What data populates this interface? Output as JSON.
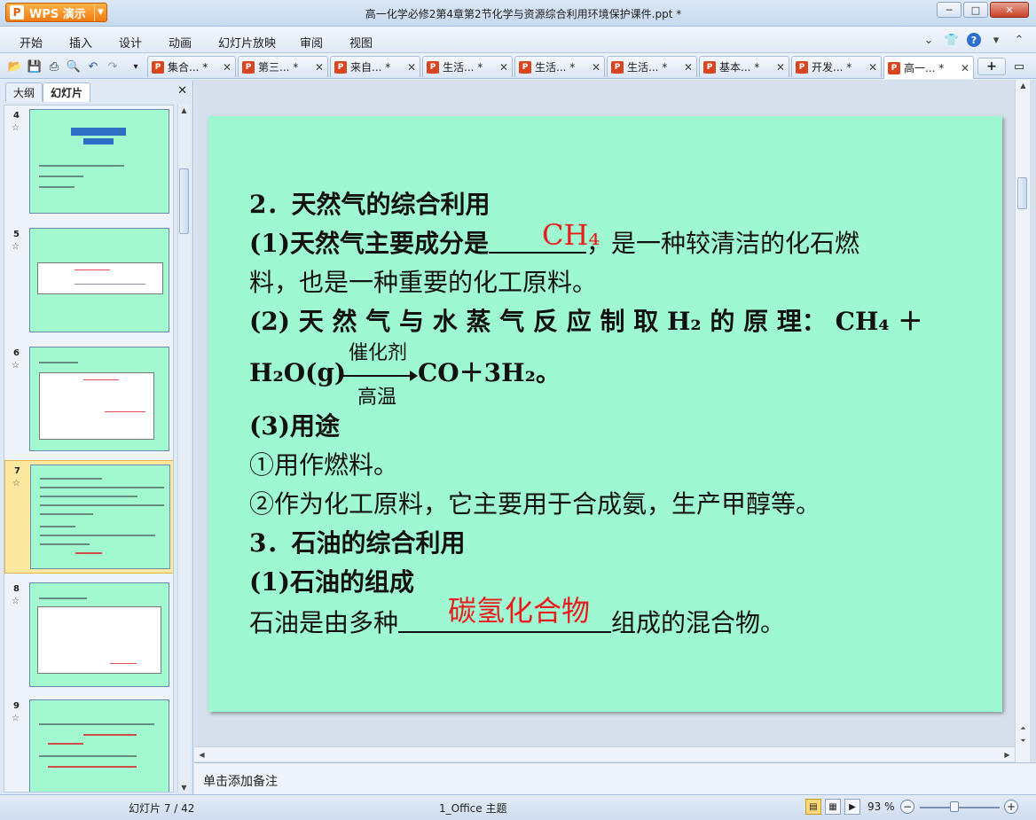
{
  "app": {
    "name": "WPS 演示",
    "logo_letter": "P"
  },
  "window": {
    "title": "高一化学必修2第4章第2节化学与资源综合利用环境保护课件.ppt *"
  },
  "menu": [
    "开始",
    "插入",
    "设计",
    "动画",
    "幻灯片放映",
    "审阅",
    "视图"
  ],
  "tabs": [
    {
      "label": "集合... *"
    },
    {
      "label": "第三... *"
    },
    {
      "label": "来自... *"
    },
    {
      "label": "生活... *"
    },
    {
      "label": "生活... *"
    },
    {
      "label": "生活... *"
    },
    {
      "label": "基本... *"
    },
    {
      "label": "开发... *"
    },
    {
      "label": "高一... *",
      "active": true
    }
  ],
  "panel": {
    "tabs": [
      "大纲",
      "幻灯片"
    ],
    "active_tab": "幻灯片",
    "slides": [
      {
        "number": "4"
      },
      {
        "number": "5"
      },
      {
        "number": "6"
      },
      {
        "number": "7",
        "selected": true
      },
      {
        "number": "8"
      },
      {
        "number": "9"
      }
    ]
  },
  "slide": {
    "background": "#9ef8d1",
    "line1": "2．天然气的综合利用",
    "line2_a": "(1)天然气主要成分是",
    "line2_blank_answer": "CH₄",
    "line2_b": "，是一种较清洁的化石燃",
    "line3": "料，也是一种重要的化工原料。",
    "line4": "(2) 天 然 气 与 水 蒸 气 反 应 制 取  H₂  的 原 理： CH₄ ＋",
    "line5_left": "H₂O(g)",
    "reaction_top": "催化剂",
    "reaction_bottom": "高温",
    "line5_right": "CO＋3H₂。",
    "line6": "(3)用途",
    "line7": "①用作燃料。",
    "line8": "②作为化工原料，它主要用于合成氨，生产甲醇等。",
    "line9": "3．石油的综合利用",
    "line10": "(1)石油的组成",
    "line11_a": "石油是由多种",
    "line11_blank_answer": "碳氢化合物",
    "line11_b": "组成的混合物。",
    "answer_color": "#e81c1c"
  },
  "notes_placeholder": "单击添加备注",
  "status": {
    "slide_info": "幻灯片 7 / 42",
    "theme": "1_Office 主题",
    "zoom": "93 %"
  }
}
